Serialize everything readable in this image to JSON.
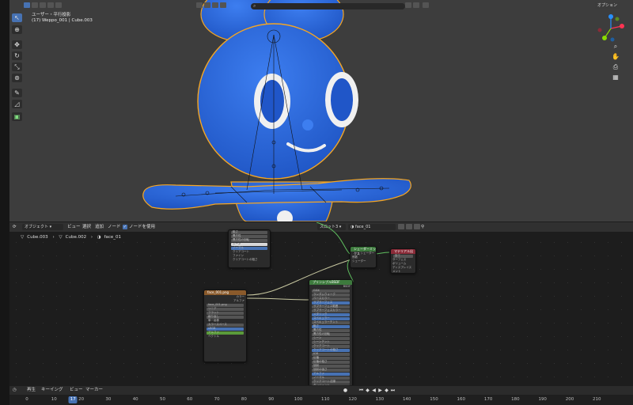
{
  "viewport": {
    "info_line1": "ユーザー・平行投影",
    "info_line2": "(17) Weppo_001 | Cube.003",
    "options_label": "オプション",
    "search_placeholder": "",
    "gizmo": {
      "x_color": "#ff3352",
      "y_color": "#8bdc00",
      "z_color": "#2890ff"
    },
    "character_color": "#2f6bd8",
    "outline_color": "#f5a623"
  },
  "node_editor": {
    "editor_icon": "node-editor-icon",
    "mode": "オブジェクト",
    "menu": [
      "ビュー",
      "選択",
      "追加",
      "ノード"
    ],
    "use_nodes_label": "ノードを使用",
    "slot": "スロット3",
    "material": "face_01",
    "breadcrumb": [
      "Cube.003",
      "Cube.002",
      "face_01"
    ],
    "nodes": {
      "top": {
        "rows": [
          "粗さ",
          "異方性",
          "異方性の回転",
          "シーン",
          "ノーマル",
          "クリアコート",
          "ファイン",
          "クリアコートの粗さ",
          "IOR",
          "伝播",
          "伝播粗さ"
        ]
      },
      "image_texture": {
        "title": "face_001.png",
        "image_name": "face_001.png",
        "rows": [
          "カラー",
          "アルファ",
          "リニア",
          "フラット",
          "繰り返し",
          "単一画像",
          "カラースペース",
          "sRGB",
          "アルファ",
          "ベクトル"
        ]
      },
      "principled": {
        "title": "プリンシプルBSDF",
        "out": "BSDF",
        "rows": [
          "GGX",
          "ランダムウォーク",
          "ベースカラー",
          "サブサーフェス",
          "サブサーフェス範囲",
          "サブサーフェスカラー",
          "メタリック",
          "スペキュラー",
          "スペキュラーチント",
          "粗さ",
          "異方性",
          "異方性の回転",
          "シーン",
          "シーンチント",
          "クリアコート",
          "クリアコートの粗さ",
          "IOR",
          "伝播",
          "伝播の粗さ",
          "放射",
          "放射の強さ",
          "アルファ",
          "ノーマル",
          "クリアコート法線",
          "タンジェント"
        ]
      },
      "mix": {
        "title": "シェーダーミックス",
        "rows": [
          "シェーダー",
          "係数",
          "シェーダー",
          "シェーダー"
        ]
      },
      "output": {
        "title": "マテリアル出力",
        "rows": [
          "全て",
          "サーフェス",
          "ボリューム",
          "ディスプレイスメント"
        ]
      }
    }
  },
  "timeline": {
    "playback_label": "再生",
    "keying_label": "キーイング",
    "view_label": "ビュー",
    "marker_label": "マーカー",
    "current_frame": "17",
    "ticks": [
      "0",
      "10",
      "20",
      "30",
      "40",
      "50",
      "60",
      "70",
      "80",
      "90",
      "100",
      "110",
      "120",
      "130",
      "140",
      "150",
      "160",
      "170",
      "180",
      "190",
      "200",
      "210"
    ]
  }
}
